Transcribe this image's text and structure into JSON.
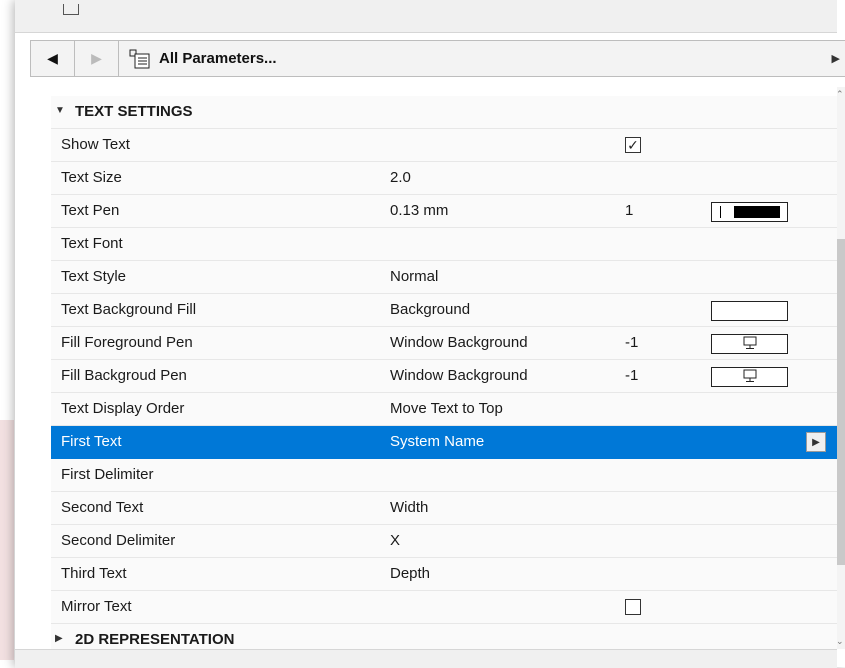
{
  "window": {
    "toolbar": {
      "back_icon": "triangle-left-icon",
      "forward_icon": "triangle-right-icon",
      "parameters_label": "All Parameters...",
      "parameters_icon": "parameter-list-icon"
    }
  },
  "sections": [
    {
      "label": "TEXT SETTINGS",
      "expanded": true
    },
    {
      "label": "2D REPRESENTATION",
      "expanded": false
    }
  ],
  "rows": [
    {
      "label": "Show Text",
      "value": "",
      "extra": "",
      "checked": true
    },
    {
      "label": "Text Size",
      "value": "2.0",
      "extra": ""
    },
    {
      "label": "Text Pen",
      "value": "0.13 mm",
      "extra": "1"
    },
    {
      "label": "Text Font",
      "value": "",
      "extra": ""
    },
    {
      "label": "Text Style",
      "value": "Normal",
      "extra": ""
    },
    {
      "label": "Text Background Fill",
      "value": "Background",
      "extra": ""
    },
    {
      "label": "Fill Foreground Pen",
      "value": "Window Background",
      "extra": "-1"
    },
    {
      "label": "Fill Backgroud Pen",
      "value": "Window Background",
      "extra": "-1"
    },
    {
      "label": "Text Display Order",
      "value": "Move Text to Top",
      "extra": ""
    },
    {
      "label": "First Text",
      "value": "System Name",
      "extra": "",
      "selected": true
    },
    {
      "label": "First Delimiter",
      "value": "",
      "extra": ""
    },
    {
      "label": "Second Text",
      "value": "Width",
      "extra": ""
    },
    {
      "label": "Second Delimiter",
      "value": "X",
      "extra": ""
    },
    {
      "label": "Third Text",
      "value": "Depth",
      "extra": ""
    },
    {
      "label": "Mirror Text",
      "value": "",
      "extra": "",
      "checked": false
    }
  ],
  "colors": {
    "selection": "#0078d7",
    "pen_swatch": "#000000"
  }
}
